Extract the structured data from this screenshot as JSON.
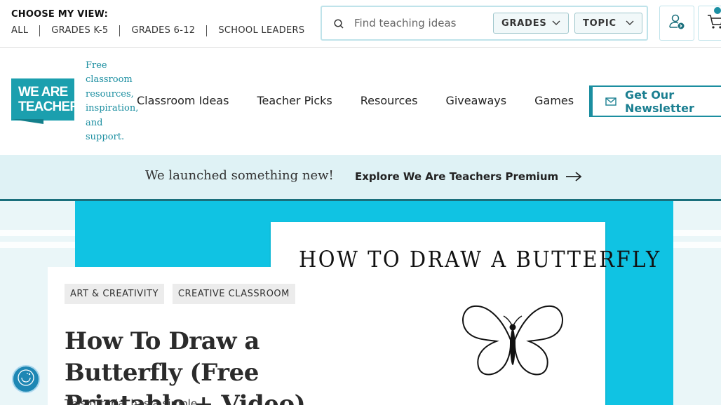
{
  "view_selector": {
    "label": "CHOOSE MY VIEW:",
    "options": [
      "ALL",
      "GRADES K-5",
      "GRADES 6-12",
      "SCHOOL LEADERS"
    ]
  },
  "search": {
    "placeholder": "Find teaching ideas",
    "grades_label": "GRADES",
    "topic_label": "TOPIC"
  },
  "logo": {
    "line1": "WE ARE",
    "line2": "TEACHERS",
    "tagline": "Free classroom resources, inspiration, and support."
  },
  "nav": {
    "links": [
      "Classroom Ideas",
      "Teacher Picks",
      "Resources",
      "Giveaways",
      "Games"
    ],
    "newsletter_label": "Get Our Newsletter"
  },
  "promo": {
    "text": "We launched something new!",
    "link_label": "Explore We Are Teachers Premium"
  },
  "article": {
    "tags": [
      "ART & CREATIVITY",
      "CREATIVE CLASSROOM"
    ],
    "title": "How To Draw a Butterfly (Free Printable + Video)",
    "intro": "This tutorial has a simple..."
  },
  "hero": {
    "paper_title": "HOW TO DRAW A BUTTERFLY"
  },
  "colors": {
    "brand_teal": "#1b9fae",
    "hero_cyan": "#10c3e3",
    "promo_bg": "#dff2f5"
  }
}
